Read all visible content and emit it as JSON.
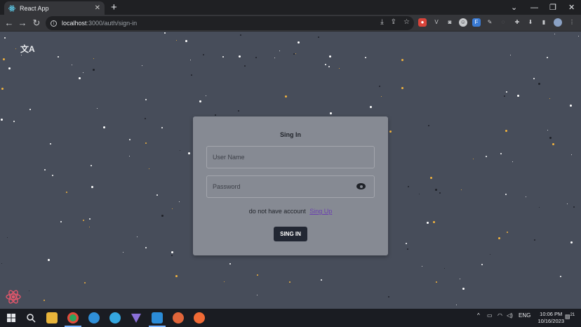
{
  "browser": {
    "tab_title": "React App",
    "url_host": "localhost",
    "url_path": ":3000/auth/sign-in"
  },
  "form": {
    "title": "Sing In",
    "username_placeholder": "User Name",
    "password_placeholder": "Password",
    "no_account_text": "do not have account",
    "signup_link": "Sing Up",
    "signin_button": "SING IN"
  },
  "taskbar": {
    "language": "ENG",
    "time": "10:06 PM",
    "date": "10/16/2023",
    "notification_count": "21"
  },
  "colors": {
    "page_background": "#474d5a",
    "card_background": "#868a93",
    "button_background": "#222733",
    "link": "#6a3fb0"
  }
}
